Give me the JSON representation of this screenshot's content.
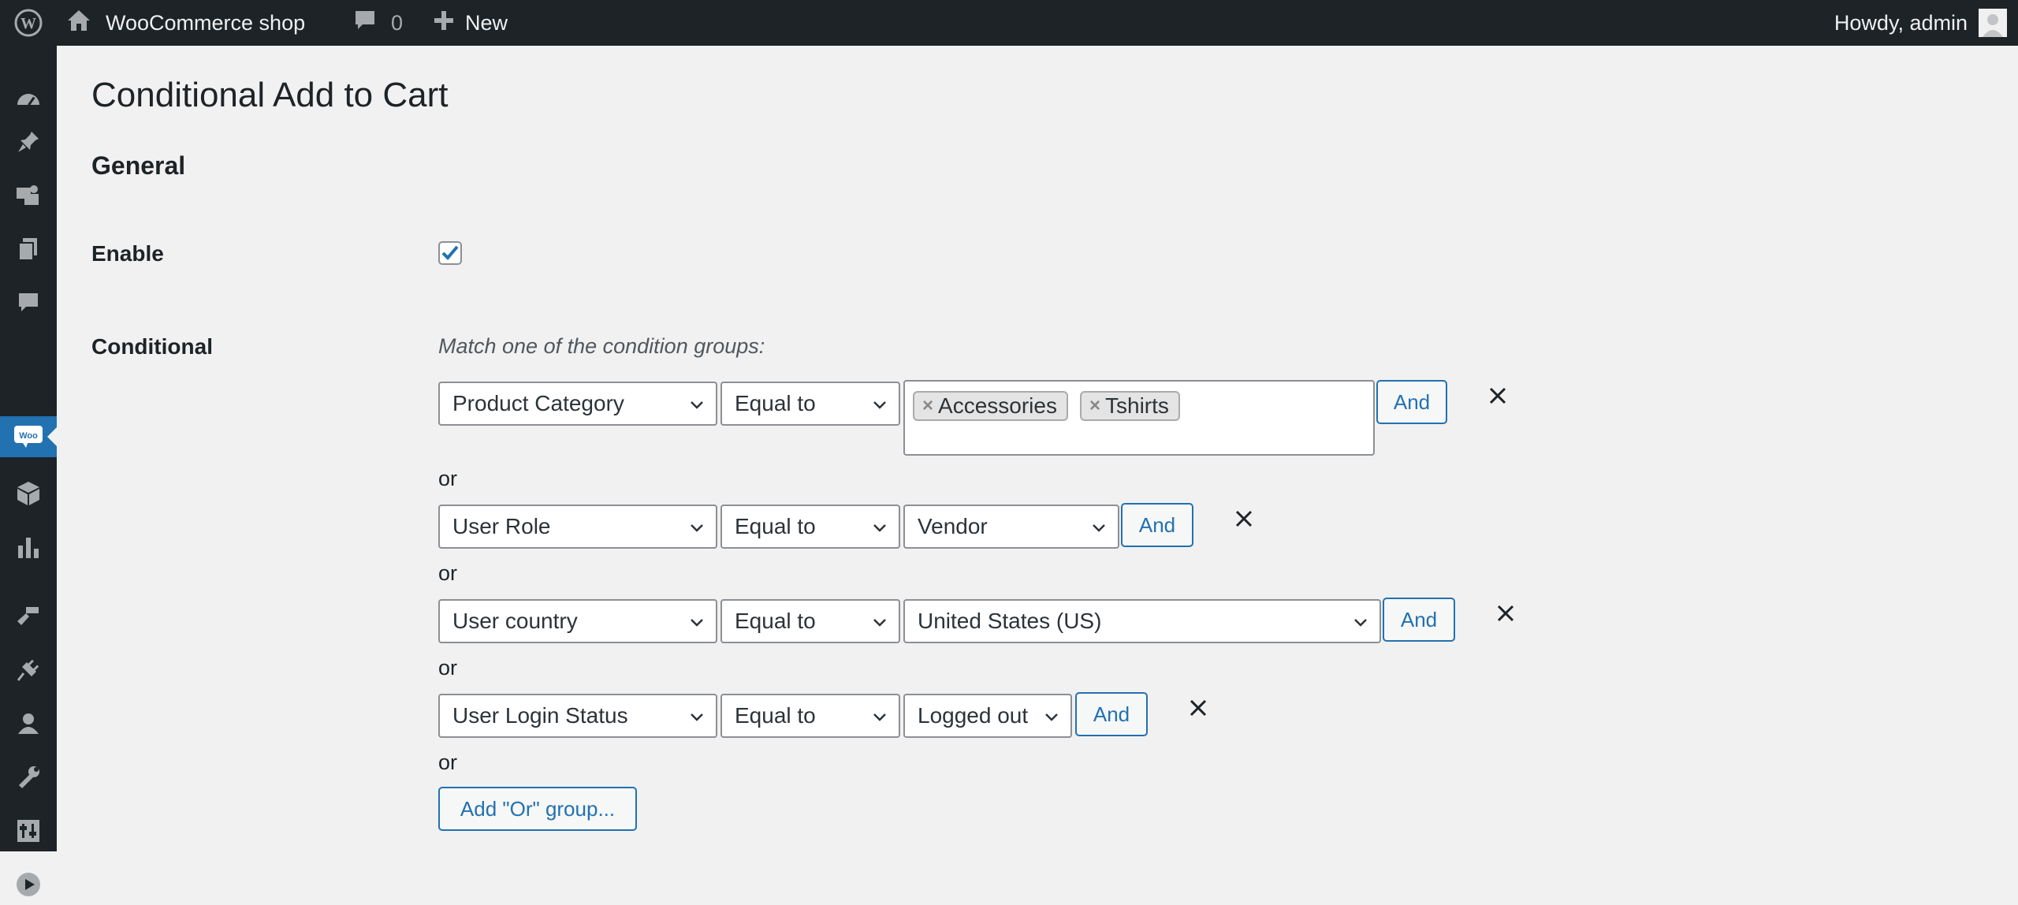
{
  "adminbar": {
    "site_name": "WooCommerce shop",
    "comments_count": "0",
    "new_label": "New",
    "howdy": "Howdy, admin"
  },
  "sidemenu": {
    "items": [
      "dashboard-icon",
      "posts-icon",
      "media-icon",
      "pages-icon",
      "comments-icon",
      "woocommerce-icon",
      "products-icon",
      "analytics-icon",
      "appearance-icon",
      "plugins-icon",
      "users-icon",
      "tools-icon",
      "settings-icon",
      "media-player-icon"
    ],
    "active": "woocommerce-icon",
    "woo_badge": "Woo"
  },
  "page": {
    "title": "Conditional Add to Cart",
    "section": "General",
    "enable_label": "Enable",
    "enable_checked": true,
    "conditional_label": "Conditional",
    "match_desc": "Match one of the condition groups:"
  },
  "groups": [
    {
      "field": "Product Category",
      "operator": "Equal to",
      "tags": [
        "Accessories",
        "Tshirts"
      ],
      "and_label": "And"
    },
    {
      "field": "User Role",
      "operator": "Equal to",
      "value": "Vendor",
      "and_label": "And"
    },
    {
      "field": "User country",
      "operator": "Equal to",
      "value": "United States (US)",
      "and_label": "And"
    },
    {
      "field": "User Login Status",
      "operator": "Equal to",
      "value": "Logged out",
      "and_label": "And"
    }
  ],
  "or_label": "or",
  "add_or_group_label": "Add \"Or\" group...",
  "colors": {
    "bar": "#1d2327",
    "accent": "#2271b1",
    "background": "#f1f1f1"
  }
}
